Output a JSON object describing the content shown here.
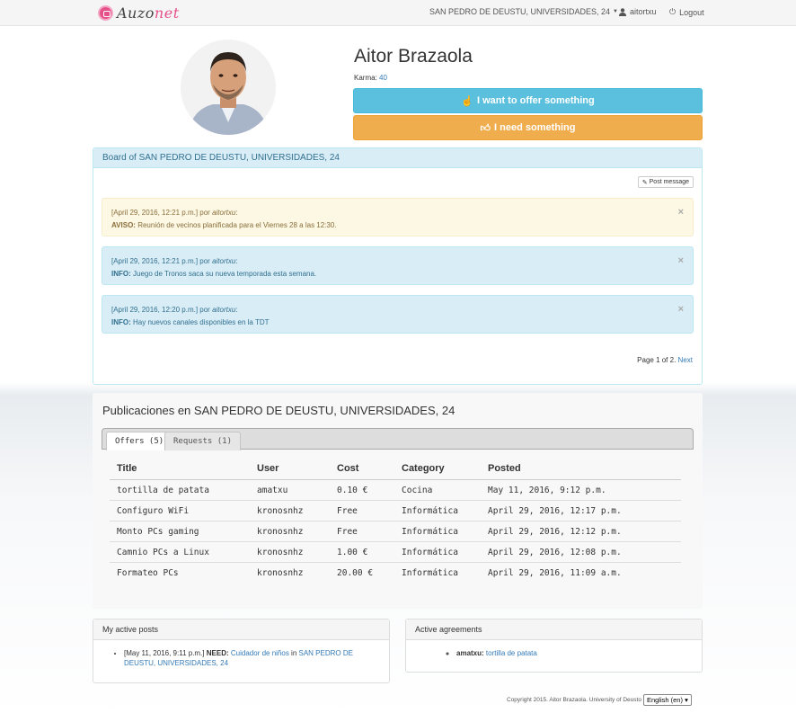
{
  "navbar": {
    "logo_text_a": "Auzo",
    "logo_text_b": "net",
    "location": "SAN PEDRO DE DEUSTU, UNIVERSIDADES, 24",
    "user": "aitortxu",
    "logout": "Logout"
  },
  "profile": {
    "name": "Aitor Brazaola",
    "karma_label": "Karma:",
    "karma_value": "40",
    "offer_button": "I want to offer something",
    "need_button": "I need something"
  },
  "board": {
    "title": "Board of SAN PEDRO DE DEUSTU, UNIVERSIDADES, 24",
    "post_button": "Post message",
    "messages": [
      {
        "date": "[April 29, 2016, 12:21 p.m.] por ",
        "author": "aitortxu",
        "colon": ":",
        "type": "AVISO:",
        "text": " Reunión de vecinos planificada para el Viernes 28 a las 12:30."
      },
      {
        "date": "[April 29, 2016, 12:21 p.m.] por ",
        "author": "aitortxu",
        "colon": ":",
        "type": "INFO:",
        "text": " Juego de Tronos saca su nueva temporada esta semana."
      },
      {
        "date": "[April 29, 2016, 12:20 p.m.] por ",
        "author": "aitortxu",
        "colon": ":",
        "type": "INFO:",
        "text": " Hay nuevos canales disponibles en la TDT"
      }
    ],
    "close_symbol": "×",
    "pager_text": "Page 1 of 2.",
    "pager_next": "Next"
  },
  "publications": {
    "title": "Publicaciones en SAN PEDRO DE DEUSTU, UNIVERSIDADES, 24",
    "tabs": [
      "Offers (5)",
      "Requests (1)"
    ],
    "columns": [
      "Title",
      "User",
      "Cost",
      "Category",
      "Posted"
    ],
    "rows": [
      [
        "tortilla de patata",
        "amatxu",
        "0.10 €",
        "Cocina",
        "May 11, 2016, 9:12 p.m."
      ],
      [
        "Configuro WiFi",
        "kronosnhz",
        "Free",
        "Informática",
        "April 29, 2016, 12:17 p.m."
      ],
      [
        "Monto PCs gaming",
        "kronosnhz",
        "Free",
        "Informática",
        "April 29, 2016, 12:12 p.m."
      ],
      [
        "Camnio PCs a Linux",
        "kronosnhz",
        "1.00 €",
        "Informática",
        "April 29, 2016, 12:08 p.m."
      ],
      [
        "Formateo PCs",
        "kronosnhz",
        "20.00 €",
        "Informática",
        "April 29, 2016, 11:09 a.m."
      ]
    ]
  },
  "active_posts": {
    "title": "My active posts",
    "item": {
      "date": "[May 11, 2016, 9:11 p.m.] ",
      "kind": "NEED:",
      "link": "Cuidador de niños",
      "in": " in ",
      "place": "SAN PEDRO DE DEUSTU, UNIVERSIDADES, 24"
    }
  },
  "agreements": {
    "title": "Active agreements",
    "item": {
      "user": "amatxu:",
      "link": "tortilla de patata"
    }
  },
  "footer": {
    "copyright": "Copyright 2015. Aitor Brazaola. University of Deusto",
    "language": "English (en)",
    "language_arrow": "▾"
  },
  "colors": {
    "info": "#5bc0de",
    "warning": "#f0ad4e",
    "link": "#337ab7"
  }
}
